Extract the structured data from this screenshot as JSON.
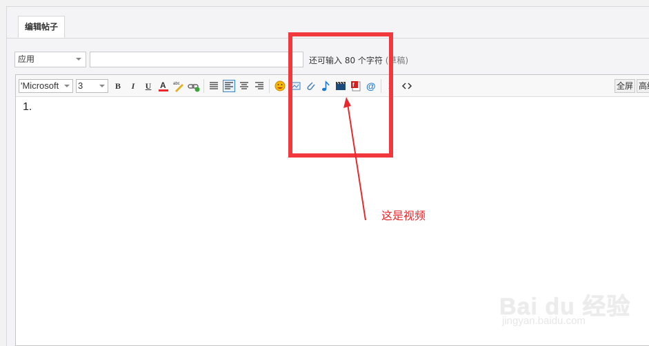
{
  "tabs": {
    "active": "编辑帖子"
  },
  "form": {
    "category_value": "应用",
    "title_value": "",
    "char_hint": "还可输入 80 个字符",
    "draft_label": "(草稿)"
  },
  "toolbar": {
    "font_family": "'Microsoft",
    "font_size": "3",
    "bold": "B",
    "italic": "I",
    "underline": "U",
    "fullscreen_label": "全屏",
    "advanced_label": "高级"
  },
  "editor": {
    "content": "1."
  },
  "annotation": {
    "text": "这是视频",
    "color": "#e8282c"
  },
  "watermark": {
    "logo": "Bai du 经验",
    "site": "jingyan.baidu.com"
  }
}
